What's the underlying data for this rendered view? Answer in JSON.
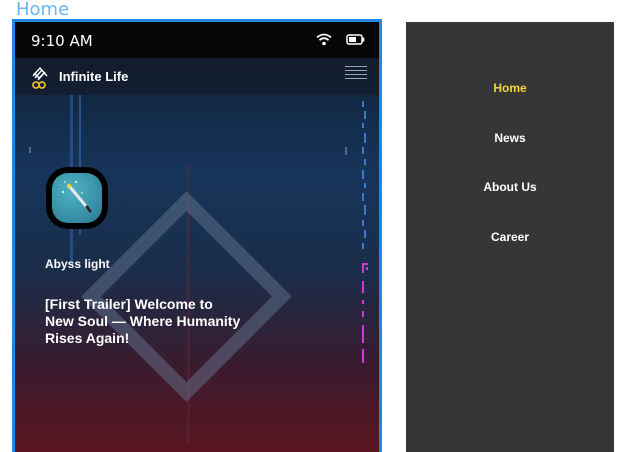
{
  "frame_label": "Home",
  "status_bar": {
    "time": "9:10 AM"
  },
  "header": {
    "brand": "Infinite Life"
  },
  "content": {
    "channel_name": "Abyss light",
    "video_title": "[First Trailer] Welcome to New Soul — Where Humanity Rises Again!"
  },
  "menu": {
    "items": [
      {
        "label": "Home",
        "active": true
      },
      {
        "label": "News",
        "active": false
      },
      {
        "label": "About Us",
        "active": false
      },
      {
        "label": "Career",
        "active": false
      }
    ]
  },
  "colors": {
    "frame_border": "#1e88e5",
    "menu_background": "#363636",
    "menu_active": "#f2d43a",
    "accent_magenta": "#d23ad6",
    "label": "#6ab6f0"
  },
  "icons": [
    "wifi-icon",
    "battery-icon",
    "logo-icon",
    "hamburger-menu-icon",
    "magic-wand-icon"
  ]
}
